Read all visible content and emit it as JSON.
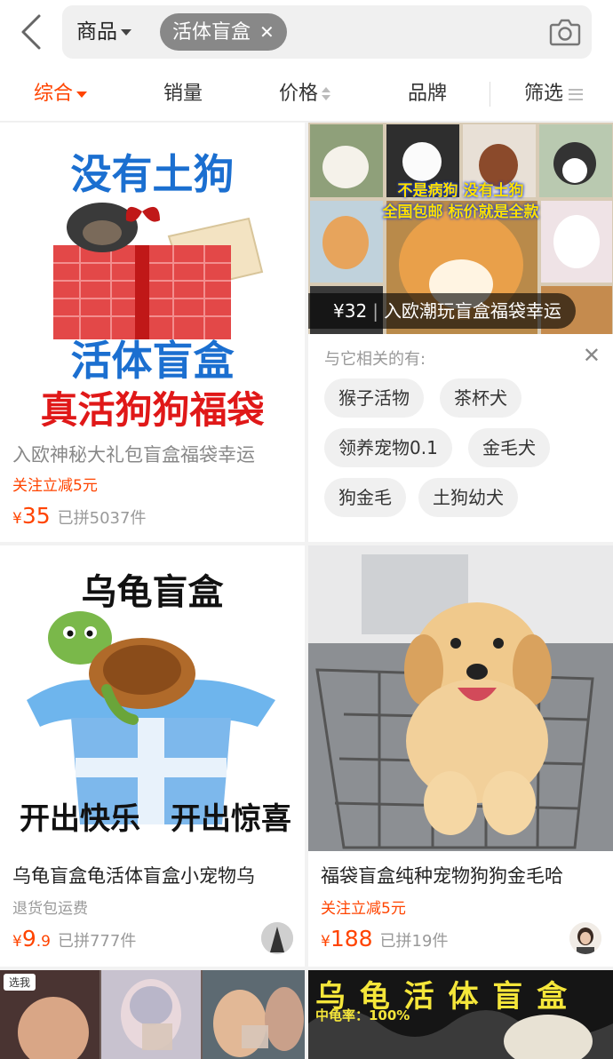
{
  "search": {
    "scope_label": "商品",
    "query_chip": "活体盲盒"
  },
  "sort_tabs": [
    {
      "label": "综合"
    },
    {
      "label": "销量"
    },
    {
      "label": "价格"
    },
    {
      "label": "品牌"
    },
    {
      "label": "筛选"
    }
  ],
  "products": [
    {
      "image_text": [
        "没有土狗",
        "活体盲盒",
        "真活狗狗福袋"
      ],
      "title": "入欧神秘大礼包盲盒福袋幸运",
      "promo": "关注立减5元",
      "price_symbol": "¥",
      "price": "35",
      "sold": "已拼5037件"
    },
    {
      "image_text": [
        "不是病狗 没有土狗",
        "全国包邮 标价就是全款"
      ],
      "banner_price": "¥32",
      "banner_title": "入欧潮玩盲盒福袋幸运"
    },
    {
      "image_text": [
        "乌龟盲盒",
        "开出快乐",
        "开出惊喜"
      ],
      "title": "乌龟盲盒龟活体盲盒小宠物乌",
      "note": "退货包运费",
      "price_symbol": "¥",
      "price_int": "9",
      "price_dec": ".9",
      "sold": "已拼777件"
    },
    {
      "title": "福袋盲盒纯种宠物狗狗金毛哈",
      "promo": "关注立减5元",
      "price_symbol": "¥",
      "price": "188",
      "sold": "已拼19件"
    },
    {
      "image_text": [
        "选我"
      ]
    },
    {
      "image_text": [
        "乌 龟 活 体 盲 盒",
        "中龟率：100%"
      ]
    }
  ],
  "related": {
    "title": "与它相关的有:",
    "close": "✕",
    "tags": [
      "猴子活物",
      "茶杯犬",
      "领养宠物0.1",
      "金毛犬",
      "狗金毛",
      "土狗幼犬"
    ]
  },
  "colors": {
    "accent": "#ff4400",
    "background": "#f2f2f2"
  },
  "icons": {
    "back": "back-chevron-icon",
    "camera": "camera-icon",
    "chip_close": "close-icon",
    "filter": "menu-lines-icon"
  }
}
